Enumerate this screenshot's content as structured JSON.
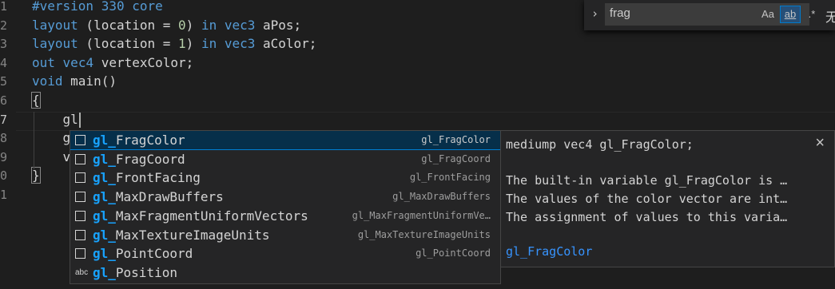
{
  "editor": {
    "line_numbers": [
      "1",
      "2",
      "3",
      "4",
      "5",
      "6",
      "7",
      "8",
      "9",
      "0",
      "1"
    ],
    "lines": [
      {
        "parts": [
          {
            "t": "#version 330 core",
            "c": "pre"
          }
        ]
      },
      {
        "parts": [
          {
            "t": "layout",
            "c": "kw"
          },
          {
            "t": " (location = ",
            "c": ""
          },
          {
            "t": "0",
            "c": "num"
          },
          {
            "t": ") ",
            "c": ""
          },
          {
            "t": "in",
            "c": "kw"
          },
          {
            "t": " ",
            "c": ""
          },
          {
            "t": "vec3",
            "c": "kw"
          },
          {
            "t": " aPos;",
            "c": ""
          }
        ]
      },
      {
        "parts": [
          {
            "t": "layout",
            "c": "kw"
          },
          {
            "t": " (location = ",
            "c": ""
          },
          {
            "t": "1",
            "c": "num"
          },
          {
            "t": ") ",
            "c": ""
          },
          {
            "t": "in",
            "c": "kw"
          },
          {
            "t": " ",
            "c": ""
          },
          {
            "t": "vec3",
            "c": "kw"
          },
          {
            "t": " aColor;",
            "c": ""
          }
        ]
      },
      {
        "parts": [
          {
            "t": "out",
            "c": "kw"
          },
          {
            "t": " ",
            "c": ""
          },
          {
            "t": "vec4",
            "c": "kw"
          },
          {
            "t": " vertexColor;",
            "c": ""
          }
        ]
      },
      {
        "parts": [
          {
            "t": "void",
            "c": "kw"
          },
          {
            "t": " main()",
            "c": ""
          }
        ]
      },
      {
        "parts": [
          {
            "t": "{",
            "c": "brace"
          }
        ]
      },
      {
        "parts": [
          {
            "t": "    gl",
            "c": ""
          }
        ]
      },
      {
        "parts": [
          {
            "t": "    gl",
            "c": ""
          }
        ]
      },
      {
        "parts": [
          {
            "t": "    ve",
            "c": ""
          }
        ]
      },
      {
        "parts": [
          {
            "t": "}",
            "c": "brace"
          }
        ]
      },
      {
        "parts": []
      }
    ]
  },
  "find_widget": {
    "chevron": "›",
    "query": "frag",
    "match_case": "Aa",
    "whole_word": "ab",
    "regex": ".*",
    "result": "无"
  },
  "suggest": {
    "items": [
      {
        "match": "gl_",
        "rest": "FragColor",
        "detail": "gl_FragColor",
        "icon": "box"
      },
      {
        "match": "gl_",
        "rest": "FragCoord",
        "detail": "gl_FragCoord",
        "icon": "box"
      },
      {
        "match": "gl_",
        "rest": "FrontFacing",
        "detail": "gl_FrontFacing",
        "icon": "box"
      },
      {
        "match": "gl_",
        "rest": "MaxDrawBuffers",
        "detail": "gl_MaxDrawBuffers",
        "icon": "box"
      },
      {
        "match": "gl_",
        "rest": "MaxFragmentUniformVectors",
        "detail": "gl_MaxFragmentUniformVe…",
        "icon": "box"
      },
      {
        "match": "gl_",
        "rest": "MaxTextureImageUnits",
        "detail": "gl_MaxTextureImageUnits",
        "icon": "box"
      },
      {
        "match": "gl_",
        "rest": "PointCoord",
        "detail": "gl_PointCoord",
        "icon": "box"
      },
      {
        "match": "gl_",
        "rest": "Position",
        "detail": "",
        "icon": "abc"
      }
    ],
    "selected_index": 0,
    "abc_label": "abc"
  },
  "docs": {
    "signature": "mediump vec4 gl_FragColor;",
    "close": "×",
    "lines": [
      "The built-in variable gl_FragColor is …",
      "The values of the color vector are int…",
      "The assignment of values to this varia…"
    ],
    "link": "gl_FragColor"
  }
}
